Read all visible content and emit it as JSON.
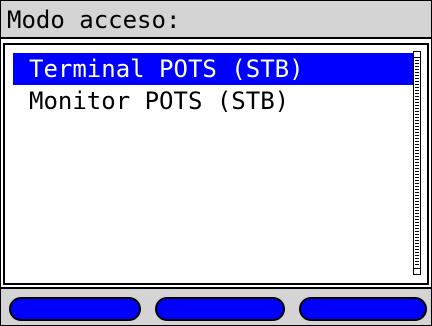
{
  "header": {
    "title": "Modo acceso:"
  },
  "list": {
    "items": [
      {
        "label": "Terminal POTS (STB)",
        "selected": true
      },
      {
        "label": "Monitor POTS (STB)",
        "selected": false
      }
    ]
  },
  "softkeys": [
    {
      "label": ""
    },
    {
      "label": ""
    },
    {
      "label": ""
    }
  ],
  "colors": {
    "selection": "#0000ff",
    "title_bar": "#d4d4d4",
    "softkey": "#0000ff"
  }
}
